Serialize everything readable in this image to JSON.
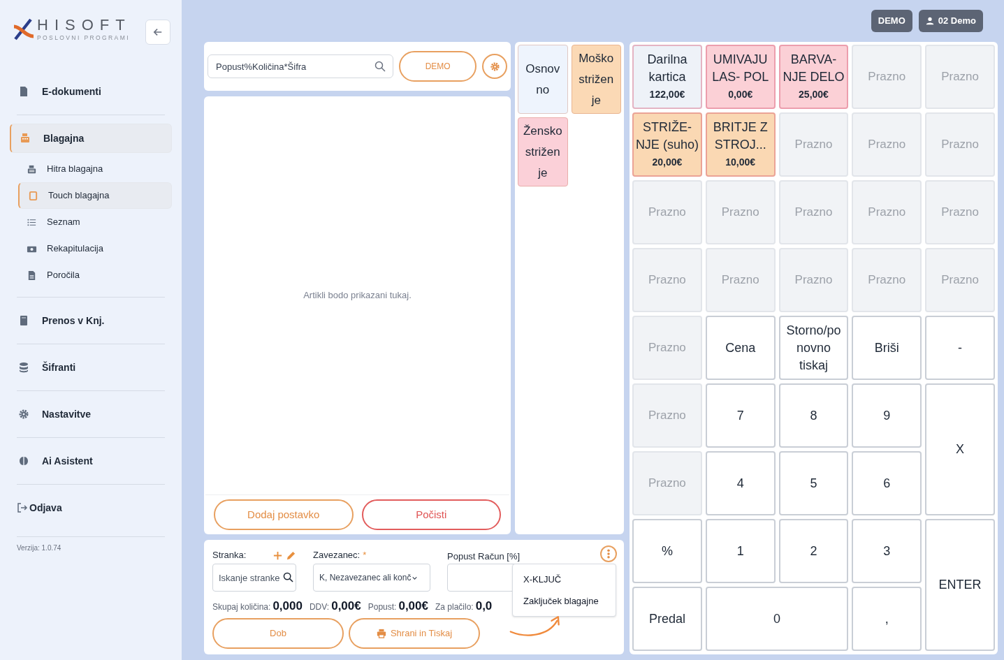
{
  "logo": {
    "title": "HISOFT",
    "subtitle": "POSLOVNI PROGRAMI"
  },
  "sidebar": {
    "items": [
      {
        "label": "E-dokumenti",
        "selected": false
      },
      {
        "label": "Blagajna",
        "selected": true,
        "children": [
          {
            "label": "Hitra blagajna",
            "selected": false
          },
          {
            "label": "Touch blagajna",
            "selected": true
          },
          {
            "label": "Seznam",
            "selected": false
          },
          {
            "label": "Rekapitulacija",
            "selected": false
          },
          {
            "label": "Poročila",
            "selected": false
          }
        ]
      },
      {
        "label": "Prenos v Knj.",
        "selected": false
      },
      {
        "label": "Šifranti",
        "selected": false
      },
      {
        "label": "Nastavitve",
        "selected": false
      },
      {
        "label": "Ai Asistent",
        "selected": false
      },
      {
        "label": "Odjava",
        "selected": false
      }
    ],
    "version": "Verzija: 1.0.74"
  },
  "header": {
    "badges": [
      {
        "label": "DEMO"
      },
      {
        "label": "02 Demo"
      }
    ]
  },
  "search": {
    "value": "Popust%Količina*Šifra",
    "company_button": "DEMO"
  },
  "items_list": {
    "empty_text": "Artikli bodo prikazani tukaj.",
    "add_button": "Dodaj postavko",
    "clear_button": "Počisti"
  },
  "categories": [
    {
      "label": "Osnov no",
      "color": "#eef4fd"
    },
    {
      "label": "Moško strižen je",
      "color": "#fbd9b5"
    },
    {
      "label": "Žensko strižen je",
      "color": "#fbd0d8"
    }
  ],
  "grid": [
    {
      "kind": "product",
      "name": "Darilna kartica",
      "price": "122,00€",
      "color": "#eef2f8"
    },
    {
      "kind": "product",
      "name": "UMIVAJU LAS- POL",
      "price": "0,00€",
      "color": "#fbd0d6"
    },
    {
      "kind": "product",
      "name": "BARVA- NJE DELO",
      "price": "25,00€",
      "color": "#fbd0d6"
    },
    {
      "kind": "empty",
      "label": "Prazno"
    },
    {
      "kind": "empty",
      "label": "Prazno"
    },
    {
      "kind": "product",
      "name": "STRIŽE- NJE (suho)",
      "price": "20,00€",
      "color": "#fad8b3"
    },
    {
      "kind": "product",
      "name": "BRITJE Z STROJ...",
      "price": "10,00€",
      "color": "#fad8b3"
    },
    {
      "kind": "empty",
      "label": "Prazno"
    },
    {
      "kind": "empty",
      "label": "Prazno"
    },
    {
      "kind": "empty",
      "label": "Prazno"
    },
    {
      "kind": "empty",
      "label": "Prazno"
    },
    {
      "kind": "empty",
      "label": "Prazno"
    },
    {
      "kind": "empty",
      "label": "Prazno"
    },
    {
      "kind": "empty",
      "label": "Prazno"
    },
    {
      "kind": "empty",
      "label": "Prazno"
    },
    {
      "kind": "empty",
      "label": "Prazno"
    },
    {
      "kind": "empty",
      "label": "Prazno"
    },
    {
      "kind": "empty",
      "label": "Prazno"
    },
    {
      "kind": "empty",
      "label": "Prazno"
    },
    {
      "kind": "empty",
      "label": "Prazno"
    },
    {
      "kind": "empty",
      "label": "Prazno"
    },
    {
      "kind": "key",
      "label": "Cena"
    },
    {
      "kind": "key",
      "label": "Storno/po novno tiskaj"
    },
    {
      "kind": "key",
      "label": "Briši"
    },
    {
      "kind": "key",
      "label": "-"
    },
    {
      "kind": "empty",
      "label": "Prazno"
    },
    {
      "kind": "key",
      "label": "7"
    },
    {
      "kind": "key",
      "label": "8"
    },
    {
      "kind": "key",
      "label": "9"
    },
    {
      "kind": "tall_key",
      "label": "X"
    },
    {
      "kind": "empty",
      "label": "Prazno"
    },
    {
      "kind": "key",
      "label": "4"
    },
    {
      "kind": "key",
      "label": "5"
    },
    {
      "kind": "key",
      "label": "6"
    },
    {
      "kind": "key",
      "label": "%"
    },
    {
      "kind": "key",
      "label": "1"
    },
    {
      "kind": "key",
      "label": "2"
    },
    {
      "kind": "key",
      "label": "3"
    },
    {
      "kind": "tall_key",
      "label": "ENTER"
    },
    {
      "kind": "key",
      "label": "Predal"
    },
    {
      "kind": "wide_key",
      "label": "0"
    },
    {
      "kind": "key",
      "label": ","
    }
  ],
  "receipt": {
    "customer_label": "Stranka:",
    "customer_placeholder": "Iskanje stranke",
    "taxpayer_label": "Zavezanec:",
    "taxpayer_required": "*",
    "taxpayer_value": "K, Nezavezanec ali konč",
    "discount_label": "Popust Račun [%]",
    "totals": [
      {
        "label": "Skupaj količina:",
        "value": "0,000"
      },
      {
        "label": "DDV:",
        "value": "0,00€"
      },
      {
        "label": "Popust:",
        "value": "0,00€"
      },
      {
        "label": "Za plačilo:",
        "value": "0,0"
      }
    ],
    "buttons": [
      {
        "label": "Dob",
        "kind": "plain"
      },
      {
        "label": "Shrani in Tiskaj",
        "kind": "print"
      }
    ],
    "menu": [
      "X-KLJUČ",
      "Zaključek blagajne"
    ]
  }
}
